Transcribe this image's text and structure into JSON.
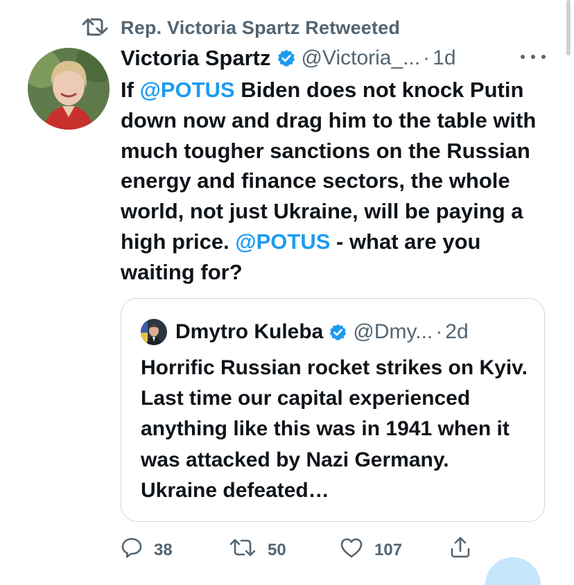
{
  "retweet": {
    "label": "Rep. Victoria Spartz Retweeted",
    "icon": "retweet-icon"
  },
  "tweet": {
    "author_name": "Victoria Spartz",
    "handle": "@Victoria_...",
    "dot": "·",
    "time": "1d",
    "text_parts": {
      "p1": "If ",
      "m1": "@POTUS",
      "p2": " Biden does not knock Putin down now and drag him to the table with much tougher sanctions on the Russian energy and finance sectors, the whole world, not just Ukraine, will be paying a high price. ",
      "m2": "@POTUS",
      "p3": " - what are you waiting for?"
    }
  },
  "quote": {
    "author_name": "Dmytro Kuleba",
    "handle": "@Dmy...",
    "dot": "·",
    "time": "2d",
    "text": "Horrific Russian rocket strikes on Kyiv. Last time our capital experienced anything like this was in 1941 when it was attacked by Nazi Germany. Ukraine defeated…"
  },
  "actions": {
    "replies": "38",
    "retweets": "50",
    "likes": "107",
    "icons": [
      "reply-icon",
      "retweet-icon",
      "like-icon",
      "share-icon"
    ]
  },
  "colors": {
    "accent": "#1d9bf0",
    "muted": "#536471",
    "text": "#0f1419",
    "border": "#cfd9de"
  }
}
